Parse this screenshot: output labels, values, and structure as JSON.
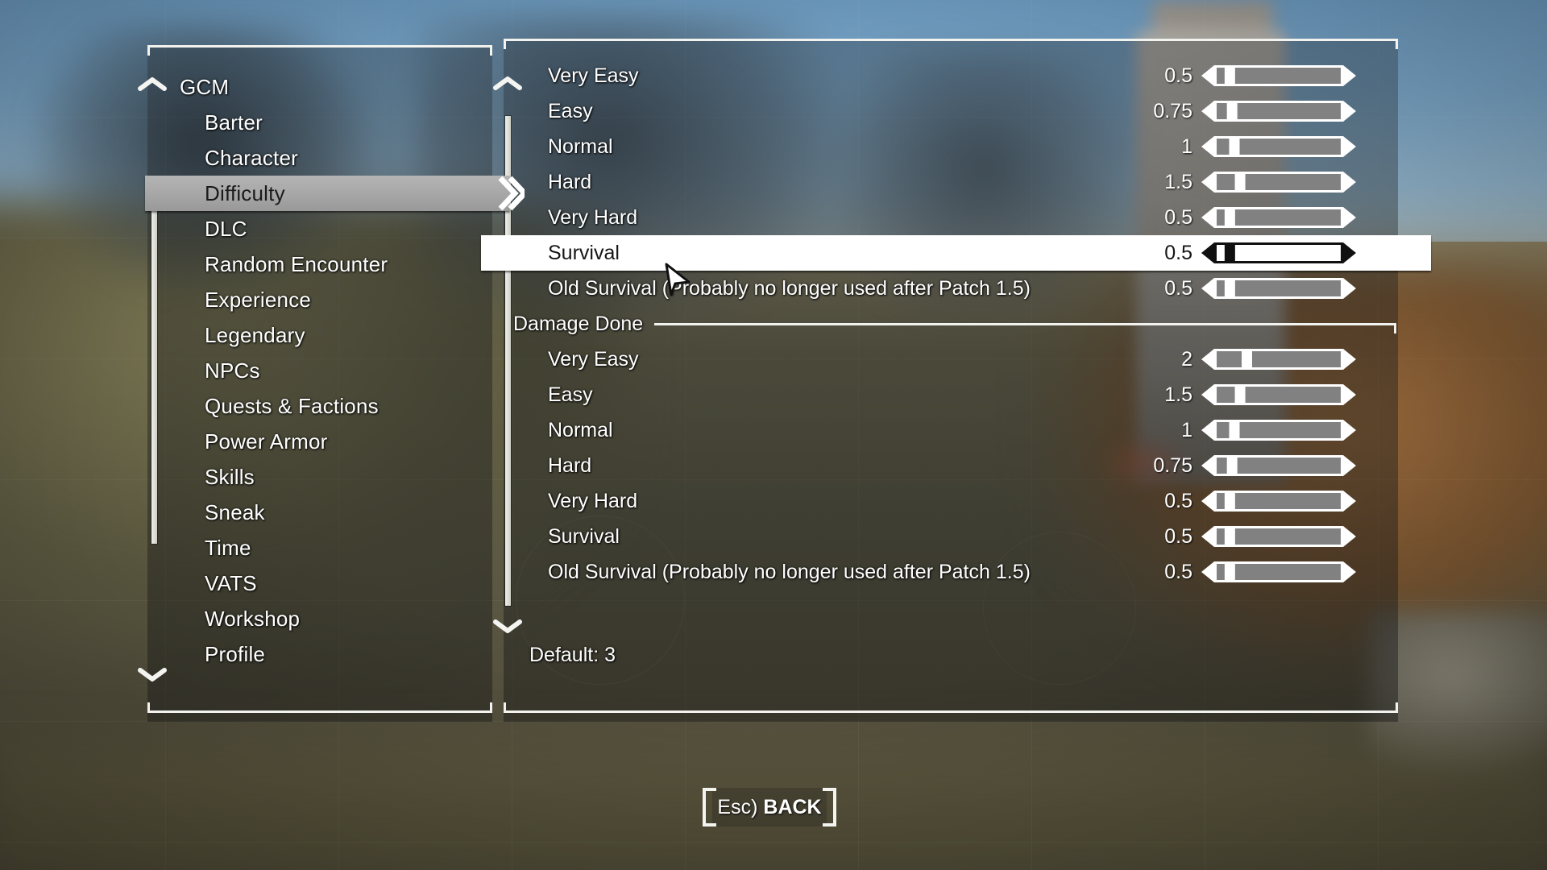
{
  "app": {
    "title": "GCM",
    "accent_selected_bg": "#a6a6a6",
    "row_selected_bg": "#ffffff",
    "frame_color": "#f2f2ee"
  },
  "sidebar": {
    "scroll_up_icon": "chevron-up-icon",
    "scroll_down_icon": "chevron-down-icon",
    "selected_index": 3,
    "items": [
      {
        "label": "GCM",
        "level": "root",
        "selected": false
      },
      {
        "label": "Barter",
        "level": "child",
        "selected": false
      },
      {
        "label": "Character",
        "level": "child",
        "selected": false
      },
      {
        "label": "Difficulty",
        "level": "child",
        "selected": true
      },
      {
        "label": "DLC",
        "level": "child",
        "selected": false
      },
      {
        "label": "Random Encounter",
        "level": "child",
        "selected": false
      },
      {
        "label": "Experience",
        "level": "child",
        "selected": false
      },
      {
        "label": "Legendary",
        "level": "child",
        "selected": false
      },
      {
        "label": "NPCs",
        "level": "child",
        "selected": false
      },
      {
        "label": "Quests & Factions",
        "level": "child",
        "selected": false
      },
      {
        "label": "Power Armor",
        "level": "child",
        "selected": false
      },
      {
        "label": "Skills",
        "level": "child",
        "selected": false
      },
      {
        "label": "Sneak",
        "level": "child",
        "selected": false
      },
      {
        "label": "Time",
        "level": "child",
        "selected": false
      },
      {
        "label": "VATS",
        "level": "child",
        "selected": false
      },
      {
        "label": "Workshop",
        "level": "child",
        "selected": false
      },
      {
        "label": "Profile",
        "level": "child",
        "selected": false
      }
    ]
  },
  "content": {
    "scroll_up_icon": "chevron-up-icon",
    "scroll_down_icon": "chevron-down-icon",
    "rows": [
      {
        "kind": "slider",
        "label": "Very Easy",
        "value": "0.5",
        "fill": 0.07,
        "selected": false
      },
      {
        "kind": "slider",
        "label": "Easy",
        "value": "0.75",
        "fill": 0.09,
        "selected": false
      },
      {
        "kind": "slider",
        "label": "Normal",
        "value": "1",
        "fill": 0.11,
        "selected": false
      },
      {
        "kind": "slider",
        "label": "Hard",
        "value": "1.5",
        "fill": 0.16,
        "selected": false
      },
      {
        "kind": "slider",
        "label": "Very Hard",
        "value": "0.5",
        "fill": 0.07,
        "selected": false
      },
      {
        "kind": "slider",
        "label": "Survival",
        "value": "0.5",
        "fill": 0.07,
        "selected": true
      },
      {
        "kind": "slider",
        "label": "Old Survival (Probably no longer used after Patch 1.5)",
        "value": "0.5",
        "fill": 0.07,
        "selected": false
      },
      {
        "kind": "section",
        "label": "Damage Done"
      },
      {
        "kind": "slider",
        "label": "Very Easy",
        "value": "2",
        "fill": 0.22,
        "selected": false
      },
      {
        "kind": "slider",
        "label": "Easy",
        "value": "1.5",
        "fill": 0.16,
        "selected": false
      },
      {
        "kind": "slider",
        "label": "Normal",
        "value": "1",
        "fill": 0.11,
        "selected": false
      },
      {
        "kind": "slider",
        "label": "Hard",
        "value": "0.75",
        "fill": 0.09,
        "selected": false
      },
      {
        "kind": "slider",
        "label": "Very Hard",
        "value": "0.5",
        "fill": 0.07,
        "selected": false
      },
      {
        "kind": "slider",
        "label": "Survival",
        "value": "0.5",
        "fill": 0.07,
        "selected": false
      },
      {
        "kind": "slider",
        "label": "Old Survival (Probably no longer used after Patch 1.5)",
        "value": "0.5",
        "fill": 0.07,
        "selected": false
      }
    ],
    "default_text": "Default: 3"
  },
  "footer": {
    "back_key": "Esc)",
    "back_label": "BACK"
  },
  "cursor": {
    "icon": "pointer-arrow-cursor"
  }
}
